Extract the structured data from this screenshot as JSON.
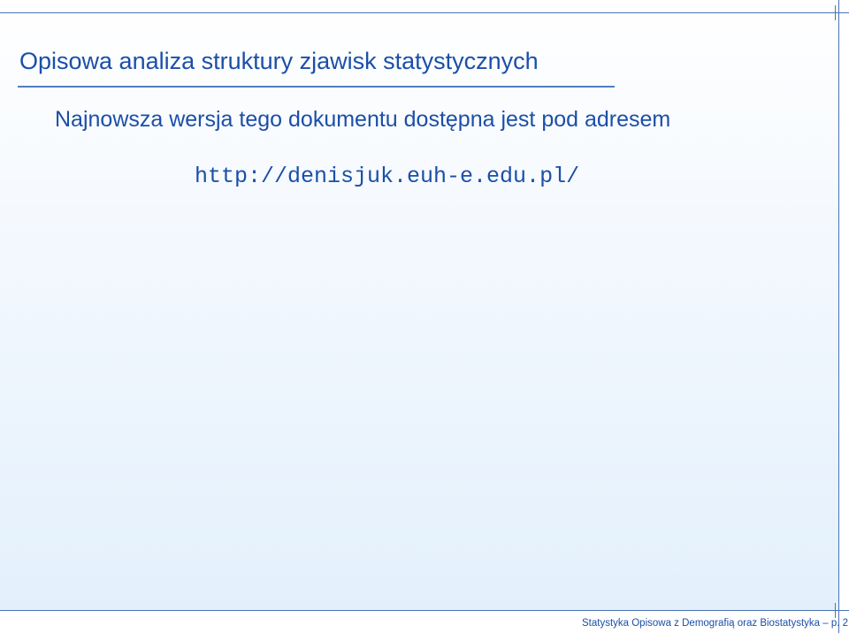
{
  "slide": {
    "title": "Opisowa analiza struktury zjawisk statystycznych",
    "body_text": "Najnowsza wersja tego dokumentu dostępna jest pod adresem",
    "url": "http://denisjuk.euh-e.edu.pl/"
  },
  "footer": {
    "text": "Statystyka Opisowa z Demografią oraz Biostatystyka – p. 2"
  }
}
